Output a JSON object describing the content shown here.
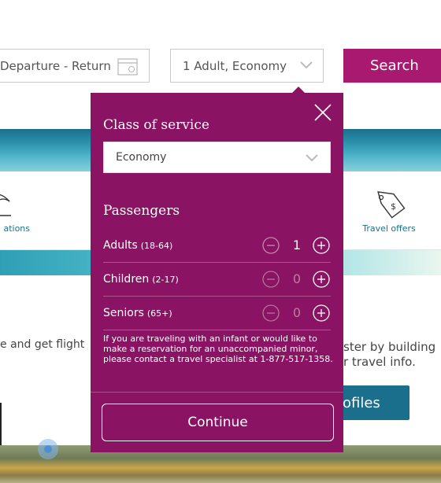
{
  "search_bar": {
    "dates_text": "Departure - Return",
    "passengers_text": "1 Adult, Economy",
    "search_label": "Search"
  },
  "background": {
    "tiles": [
      {
        "label": "ations",
        "icon": "umbrella-icon"
      },
      {
        "label": "Travel offers",
        "icon": "price-tag-icon"
      }
    ],
    "promo_left": "e and get flight",
    "promo_right_line1": "ster by building",
    "promo_right_line2": "r travel info.",
    "profiles_label": "rofiles"
  },
  "popover": {
    "class_title": "Class of service",
    "class_value": "Economy",
    "passengers_title": "Passengers",
    "rows": [
      {
        "name": "Adults",
        "age": "(18-64)",
        "count": "1"
      },
      {
        "name": "Children",
        "age": "(2-17)",
        "count": "0"
      },
      {
        "name": "Seniors",
        "age": "(65+)",
        "count": "0"
      }
    ],
    "note": "If you are traveling with an infant or would like to make a reservation for an unaccompanied minor, please contact a travel specialist at 1-877-517-1358.",
    "continue_label": "Continue"
  },
  "colors": {
    "brand": "#8a1463",
    "search_button": "#a8196f",
    "teal": "#1a6f8c"
  }
}
